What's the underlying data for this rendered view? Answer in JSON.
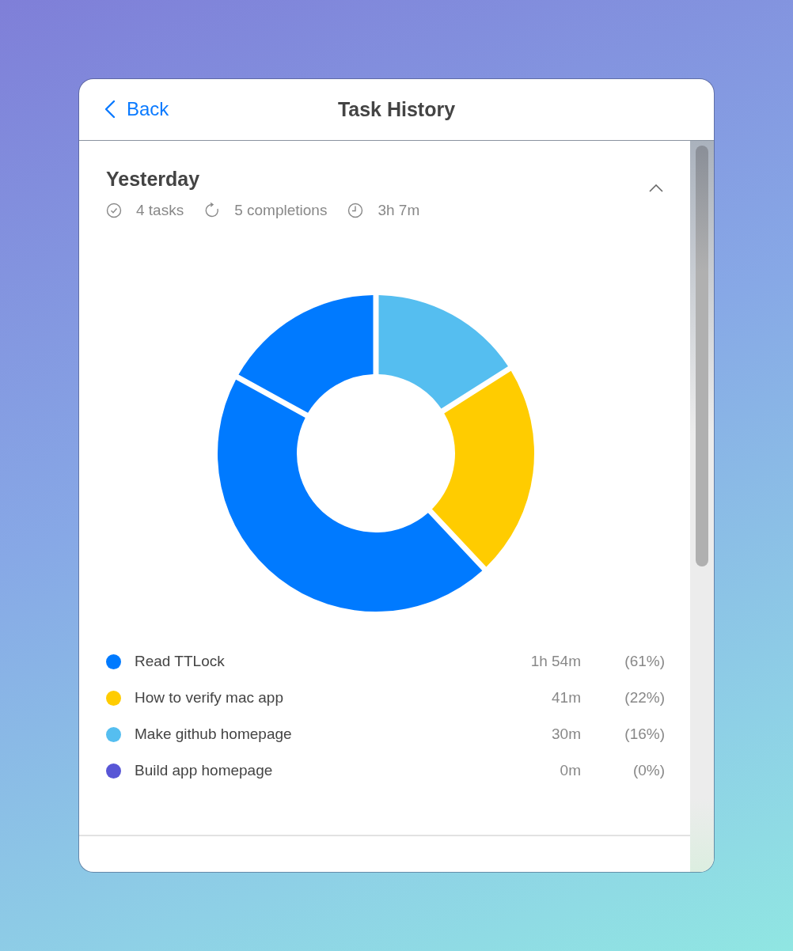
{
  "header": {
    "back": "Back",
    "title": "Task History"
  },
  "section": {
    "title": "Yesterday",
    "expanded": true,
    "stats": [
      {
        "kind": "tasks",
        "text": "4 tasks"
      },
      {
        "kind": "completions",
        "text": "5 completions"
      },
      {
        "kind": "time",
        "text": "3h 7m"
      }
    ]
  },
  "chart_data": {
    "type": "donut",
    "values": [
      16,
      22,
      45,
      17
    ],
    "colors": [
      "#55bef0",
      "#ffcc00",
      "#007aff",
      "#007aff"
    ]
  },
  "legend": [
    {
      "name": "Read TTLock",
      "duration": "1h 54m",
      "percent": "(61%)",
      "color": "#007aff"
    },
    {
      "name": "How to verify mac app",
      "duration": "41m",
      "percent": "(22%)",
      "color": "#ffcc00"
    },
    {
      "name": "Make github homepage",
      "duration": "30m",
      "percent": "(16%)",
      "color": "#55bef0"
    },
    {
      "name": "Build app homepage",
      "duration": "0m",
      "percent": "(0%)",
      "color": "#5856d6"
    }
  ]
}
